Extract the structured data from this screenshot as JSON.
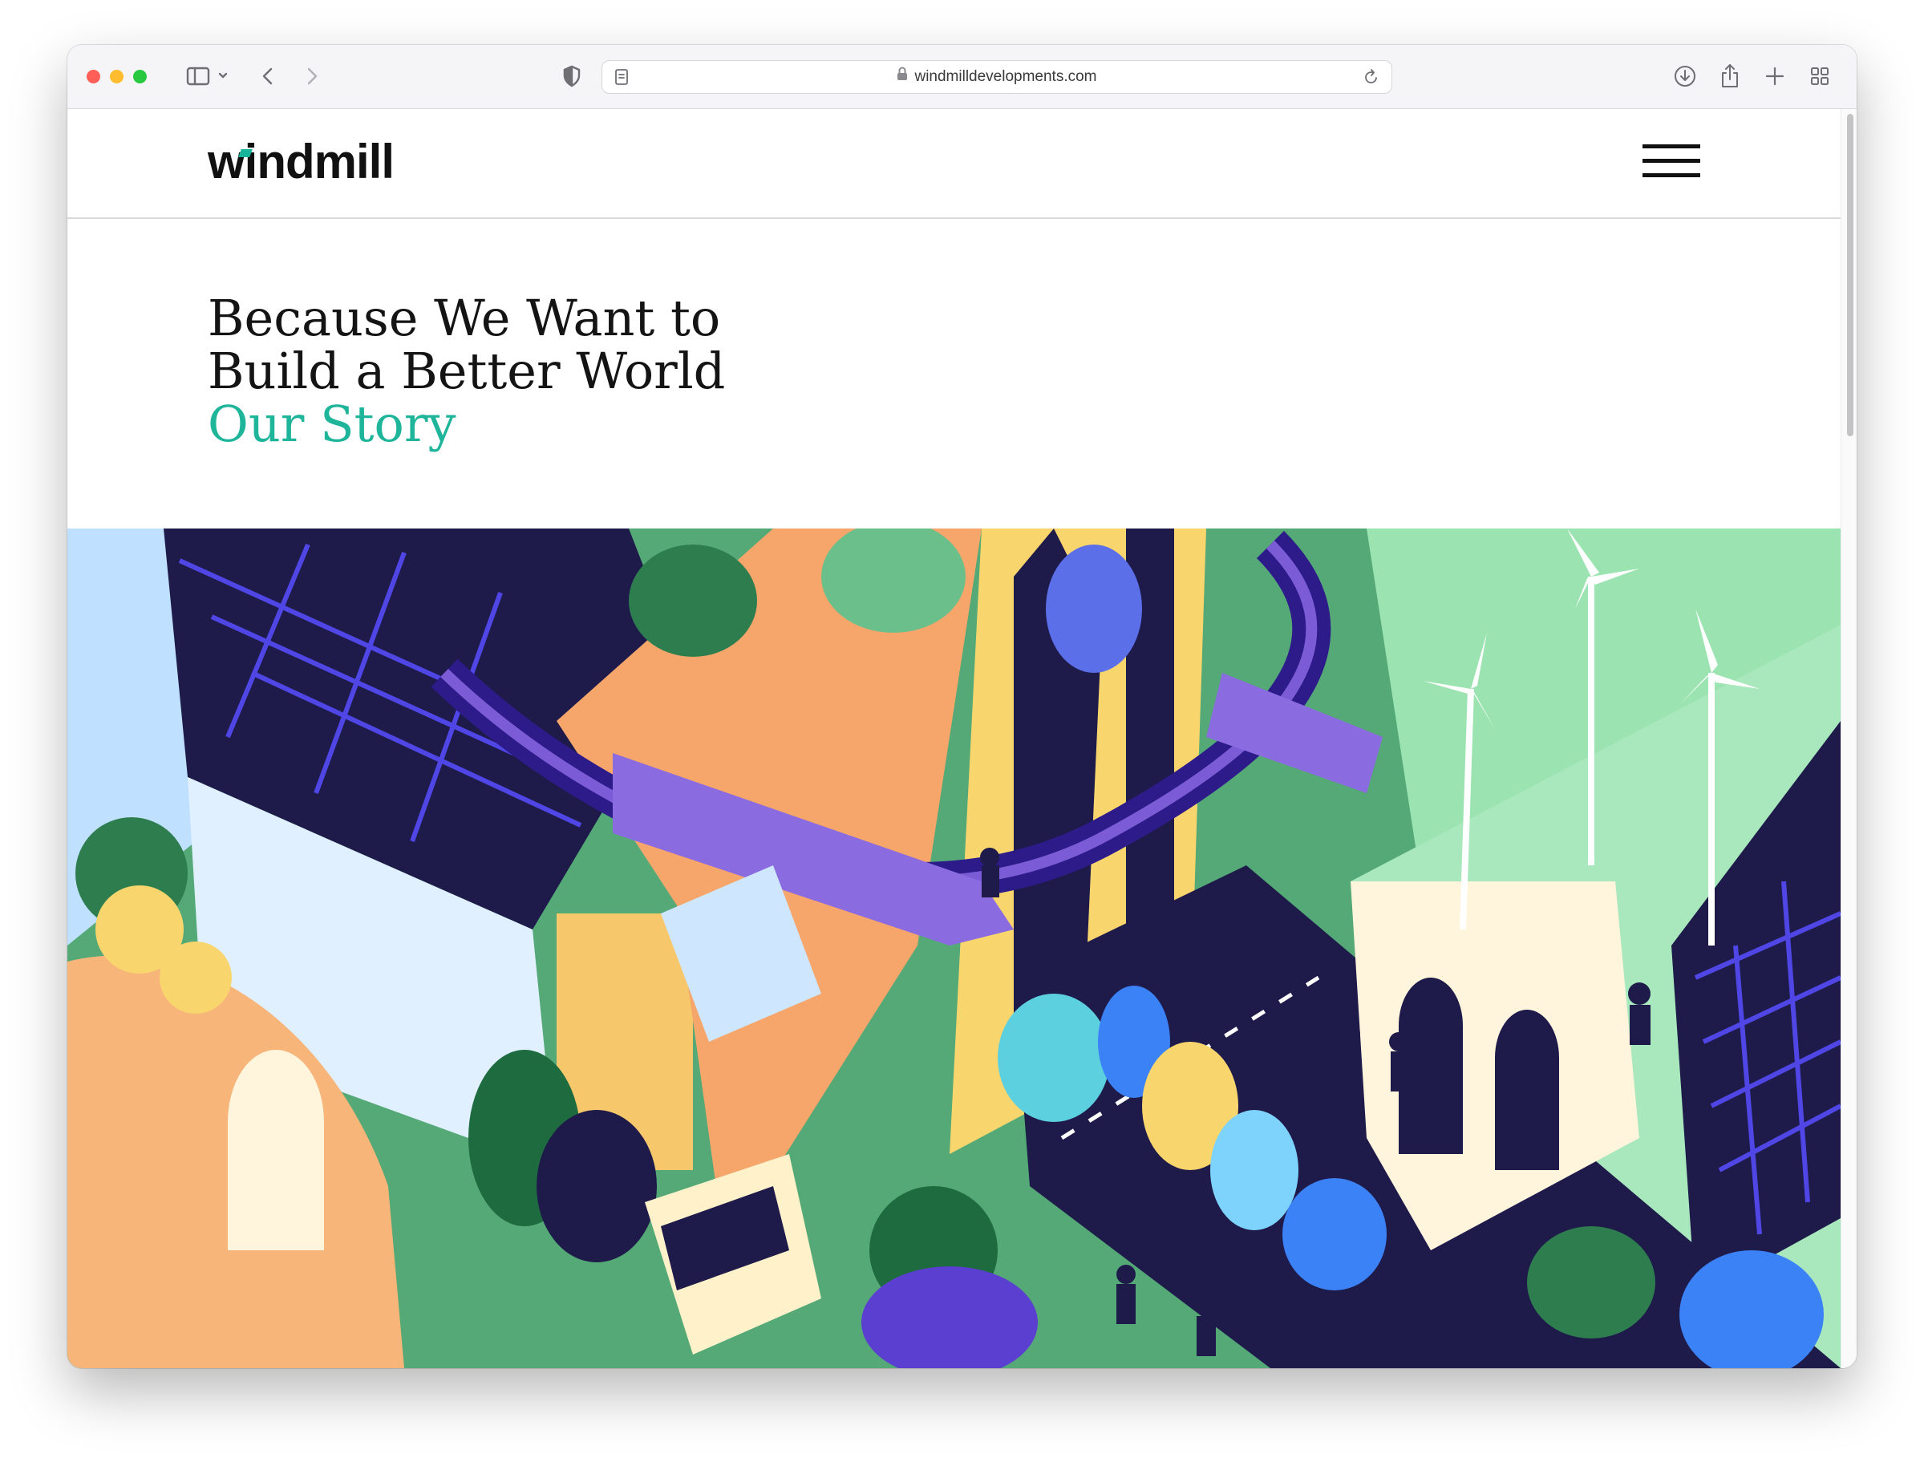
{
  "browser": {
    "url": "windmilldevelopments.com",
    "traffic_lights": {
      "close": "#ff5f57",
      "minimize": "#febc2e",
      "zoom": "#28c840"
    }
  },
  "site": {
    "logo_text": "windmill",
    "menu_icon": "hamburger-menu-icon"
  },
  "hero": {
    "line1": "Because We Want to",
    "line2": "Build a Better World",
    "accent": "Our Story",
    "accent_color": "#1fb59b"
  },
  "illustration": {
    "kind": "isometric green city illustration",
    "colors": {
      "navy": "#1e1b4b",
      "indigo": "#3730a3",
      "purple": "#7c5cd6",
      "green": "#2f8f5b",
      "mint": "#9be3b0",
      "orange": "#f6a66b",
      "yellow": "#f9d56e",
      "sky": "#bfe0ff"
    }
  }
}
